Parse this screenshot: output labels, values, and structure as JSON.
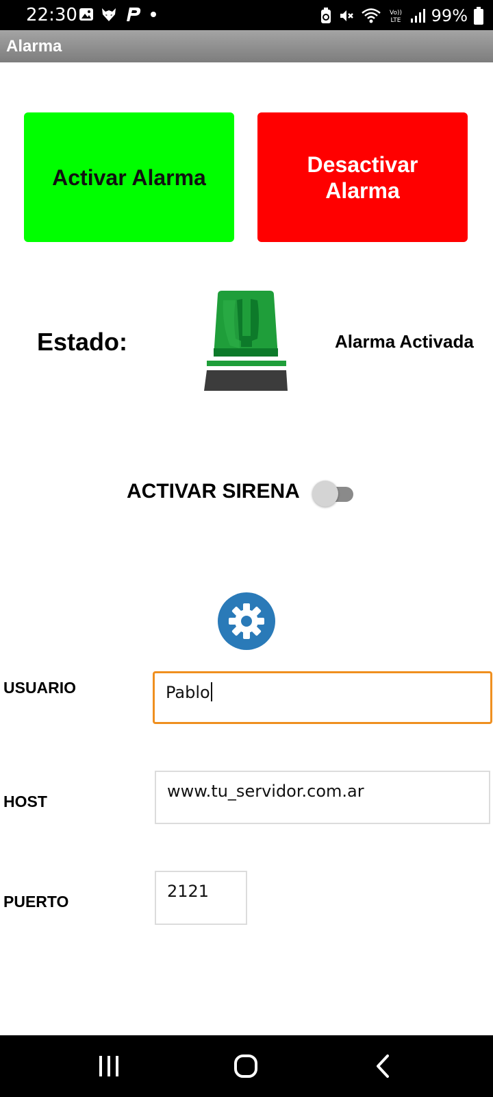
{
  "status_bar": {
    "time": "22:30",
    "battery_text": "99%",
    "left_icons": [
      "image-icon",
      "wolf-icon",
      "p-icon",
      "dot-icon"
    ],
    "right_icons": [
      "battery-saver-icon",
      "mute-icon",
      "wifi-icon",
      "volte-icon",
      "signal-icon",
      "battery-icon"
    ]
  },
  "app": {
    "title": "Alarma"
  },
  "buttons": {
    "activate": "Activar Alarma",
    "deactivate": "Desactivar Alarma",
    "activate_color": "#00ff00",
    "deactivate_color": "#ff0000"
  },
  "status": {
    "label": "Estado:",
    "value": "Alarma Activada",
    "beacon_color": "#1f9e3a",
    "beacon_icon": "siren-icon"
  },
  "siren": {
    "label": "ACTIVAR SIRENA",
    "enabled": false
  },
  "settings": {
    "icon": "gear-icon",
    "color": "#2a7ab8"
  },
  "form": {
    "user_label": "USUARIO",
    "user_value": "Pablo",
    "host_label": "HOST",
    "host_value": "www.tu_servidor.com.ar",
    "port_label": "PUERTO",
    "port_value": "2121",
    "focus_color": "#ef8f1f"
  },
  "nav": {
    "icons": [
      "recent-apps-icon",
      "home-icon",
      "back-icon"
    ]
  }
}
